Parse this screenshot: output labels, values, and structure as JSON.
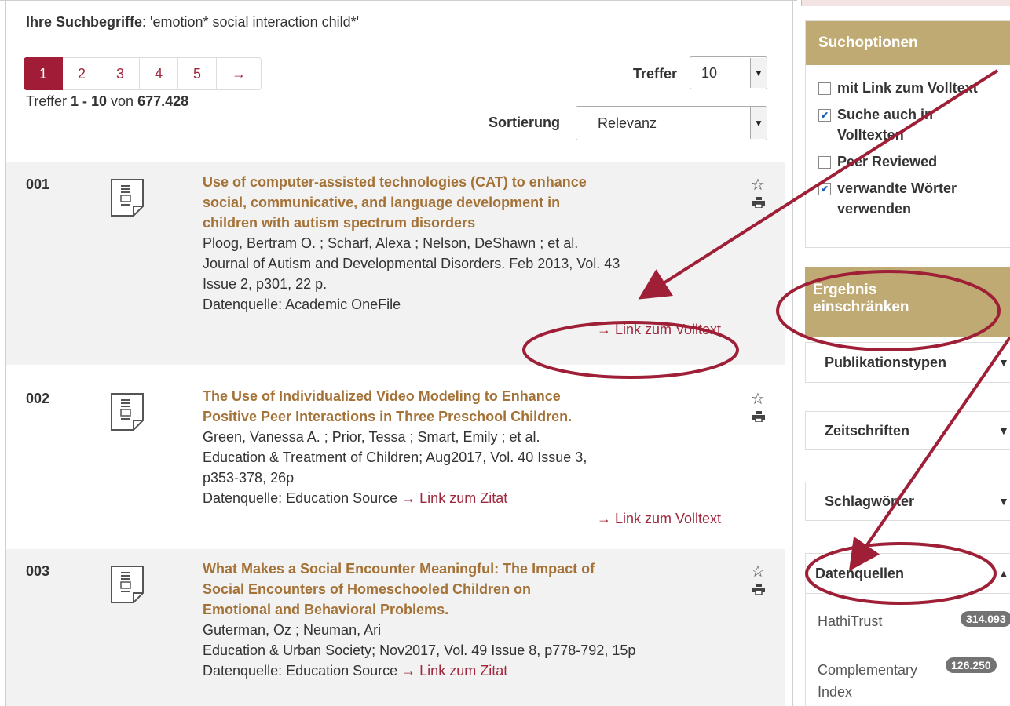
{
  "search": {
    "label": "Ihre Suchbegriffe",
    "query": ": 'emotion* social interaction child*'"
  },
  "pagination": {
    "pages": [
      "1",
      "2",
      "3",
      "4",
      "5"
    ],
    "next": "→",
    "active": "1"
  },
  "results_per_page": {
    "label": "Treffer",
    "value": "10"
  },
  "count": {
    "prefix": "Treffer ",
    "range": "1 - 10",
    "mid": " von ",
    "total": "677.428"
  },
  "sort": {
    "label": "Sortierung",
    "value": "Relevanz"
  },
  "results": [
    {
      "num": "001",
      "title_lines": [
        "Use of computer-assisted technologies (CAT) to enhance",
        "social, communicative, and language development in",
        "children with autism spectrum disorders"
      ],
      "meta_lines": [
        "Ploog, Bertram O. ; Scharf, Alexa ; Nelson, DeShawn ; et al.",
        "Journal of Autism and Developmental Disorders. Feb 2013, Vol. 43",
        "Issue 2, p301, 22 p.",
        "Datenquelle: Academic OneFile"
      ],
      "fulltext_link": "→ Link zum Volltext"
    },
    {
      "num": "002",
      "title_lines": [
        "The Use of Individualized Video Modeling to Enhance",
        "Positive Peer Interactions in Three Preschool Children."
      ],
      "meta_lines": [
        "Green, Vanessa A. ; Prior, Tessa ; Smart, Emily ; et al.",
        "Education & Treatment of Children; Aug2017, Vol. 40 Issue 3,",
        "p353-378, 26p"
      ],
      "source": "Datenquelle: Education Source ",
      "citation_link": "→ Link zum Zitat",
      "fulltext_link": "→ Link zum Volltext"
    },
    {
      "num": "003",
      "title_lines": [
        "What Makes a Social Encounter Meaningful: The Impact of",
        "Social Encounters of Homeschooled Children on",
        "Emotional and Behavioral Problems."
      ],
      "meta_lines": [
        "Guterman, Oz ; Neuman, Ari",
        "Education & Urban Society; Nov2017, Vol. 49 Issue 8, p778-792, 15p"
      ],
      "source": "Datenquelle: Education Source ",
      "citation_link": "→ Link zum Zitat"
    }
  ],
  "sidebar": {
    "options_title": "Suchoptionen",
    "options": [
      {
        "label": "mit Link zum Volltext",
        "checked": false
      },
      {
        "label": "Suche auch in Volltexten",
        "checked": true
      },
      {
        "label": "Peer Reviewed",
        "checked": false
      },
      {
        "label": "verwandte Wörter verwenden",
        "checked": true
      }
    ],
    "refine_title_1": "Ergebnis",
    "refine_title_2": "einschränken",
    "facets": [
      "Publikationstypen",
      "Zeitschriften",
      "Schlagwörter",
      "Datenquellen"
    ],
    "datasources": [
      {
        "name": "HathiTrust",
        "count": "314.093"
      },
      {
        "name_1": "Complementary",
        "name_2": "Index",
        "count": "126.250"
      }
    ]
  },
  "colors": {
    "accent": "#a11c36",
    "gold": "#c0aa74",
    "title": "#a47236",
    "annotation": "#9e1f36"
  }
}
